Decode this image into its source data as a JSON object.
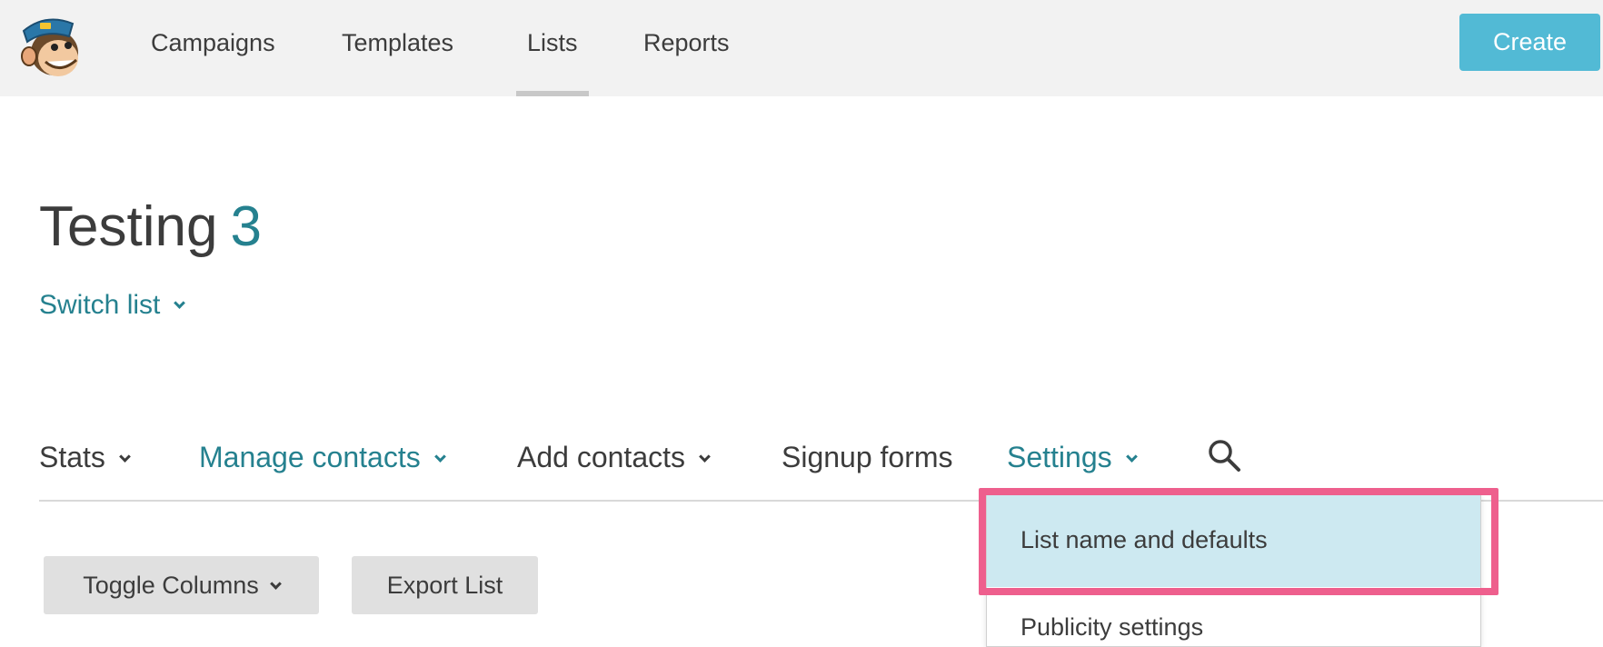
{
  "header": {
    "logo_icon": "freddie-monkey-logo",
    "nav": [
      {
        "label": "Campaigns",
        "active": false
      },
      {
        "label": "Templates",
        "active": false
      },
      {
        "label": "Lists",
        "active": true
      },
      {
        "label": "Reports",
        "active": false
      }
    ],
    "create_label": "Create"
  },
  "page": {
    "title": "Testing",
    "count": "3",
    "switch_list_label": "Switch list"
  },
  "subnav": {
    "items": [
      {
        "label": "Stats",
        "has_dropdown": true
      },
      {
        "label": "Manage contacts",
        "has_dropdown": true
      },
      {
        "label": "Add contacts",
        "has_dropdown": true
      },
      {
        "label": "Signup forms",
        "has_dropdown": false
      },
      {
        "label": "Settings",
        "has_dropdown": true
      }
    ],
    "search_icon": "search-icon"
  },
  "toolbar": {
    "toggle_columns_label": "Toggle Columns",
    "export_list_label": "Export List"
  },
  "settings_menu": {
    "items": [
      {
        "label": "List name and defaults",
        "highlighted": true
      },
      {
        "label": "Publicity settings",
        "highlighted": false
      }
    ]
  },
  "colors": {
    "accent_teal": "#25818f",
    "create_button": "#52bad5",
    "highlight_annotation": "#ee5f8d",
    "menu_hover": "#cde9f1"
  }
}
